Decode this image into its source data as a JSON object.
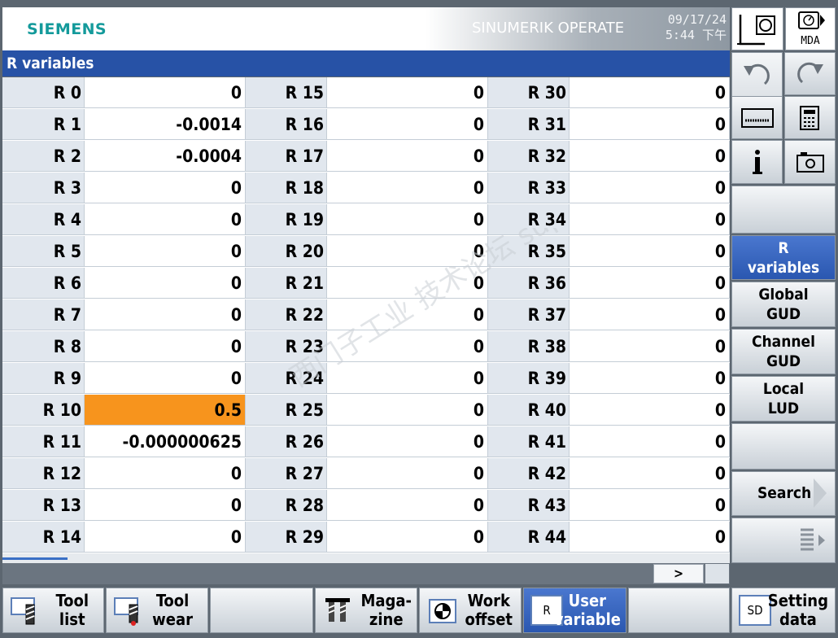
{
  "header": {
    "logo": "SIEMENS",
    "product": "SINUMERIK OPERATE",
    "date": "09/17/24",
    "time": "5:44 下午"
  },
  "top_icons": {
    "mode_label": "MDA"
  },
  "title": "R variables",
  "rvars": [
    {
      "name": "R 0",
      "value": "0"
    },
    {
      "name": "R 1",
      "value": "-0.0014"
    },
    {
      "name": "R 2",
      "value": "-0.0004"
    },
    {
      "name": "R 3",
      "value": "0"
    },
    {
      "name": "R 4",
      "value": "0"
    },
    {
      "name": "R 5",
      "value": "0"
    },
    {
      "name": "R 6",
      "value": "0"
    },
    {
      "name": "R 7",
      "value": "0"
    },
    {
      "name": "R 8",
      "value": "0"
    },
    {
      "name": "R 9",
      "value": "0"
    },
    {
      "name": "R 10",
      "value": "0.5"
    },
    {
      "name": "R 11",
      "value": "-0.000000625"
    },
    {
      "name": "R 12",
      "value": "0"
    },
    {
      "name": "R 13",
      "value": "0"
    },
    {
      "name": "R 14",
      "value": "0"
    },
    {
      "name": "R 15",
      "value": "0"
    },
    {
      "name": "R 16",
      "value": "0"
    },
    {
      "name": "R 17",
      "value": "0"
    },
    {
      "name": "R 18",
      "value": "0"
    },
    {
      "name": "R 19",
      "value": "0"
    },
    {
      "name": "R 20",
      "value": "0"
    },
    {
      "name": "R 21",
      "value": "0"
    },
    {
      "name": "R 22",
      "value": "0"
    },
    {
      "name": "R 23",
      "value": "0"
    },
    {
      "name": "R 24",
      "value": "0"
    },
    {
      "name": "R 25",
      "value": "0"
    },
    {
      "name": "R 26",
      "value": "0"
    },
    {
      "name": "R 27",
      "value": "0"
    },
    {
      "name": "R 28",
      "value": "0"
    },
    {
      "name": "R 29",
      "value": "0"
    },
    {
      "name": "R 30",
      "value": "0"
    },
    {
      "name": "R 31",
      "value": "0"
    },
    {
      "name": "R 32",
      "value": "0"
    },
    {
      "name": "R 33",
      "value": "0"
    },
    {
      "name": "R 34",
      "value": "0"
    },
    {
      "name": "R 35",
      "value": "0"
    },
    {
      "name": "R 36",
      "value": "0"
    },
    {
      "name": "R 37",
      "value": "0"
    },
    {
      "name": "R 38",
      "value": "0"
    },
    {
      "name": "R 39",
      "value": "0"
    },
    {
      "name": "R 40",
      "value": "0"
    },
    {
      "name": "R 41",
      "value": "0"
    },
    {
      "name": "R 42",
      "value": "0"
    },
    {
      "name": "R 43",
      "value": "0"
    },
    {
      "name": "R 44",
      "value": "0"
    }
  ],
  "selected": "R 10",
  "scroll_next_label": ">",
  "vertical_softkeys": {
    "r_variables": "R\nvariables",
    "global_gud": "Global\nGUD",
    "channel_gud": "Channel\nGUD",
    "local_lud": "Local\nLUD",
    "search": "Search"
  },
  "horizontal_softkeys": {
    "tool_list": "Tool\nlist",
    "tool_wear": "Tool\nwear",
    "magazine": "Maga-\nzine",
    "work_offset": "Work\noffset",
    "user_variable": "User\nvariable",
    "setting_data": "Setting\ndata",
    "user_var_icon_letter": "R",
    "setting_icon_letters": "SD"
  },
  "watermark": "西门子工业  技术论坛\nsupport.industry.siemens.com/cs",
  "colors": {
    "title_bar": "#2752a6",
    "selection": "#f7941d",
    "logo": "#149a9b",
    "active_softkey": "#2a57b0"
  }
}
